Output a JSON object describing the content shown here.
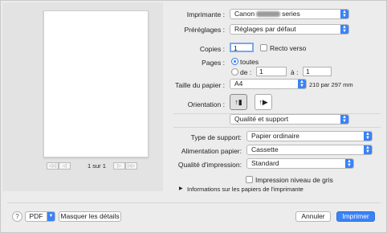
{
  "colors": {
    "accent": "#3a82f6"
  },
  "preview": {
    "first_label": "◁◁",
    "prev_label": "◁",
    "page_count": "1 sur 1",
    "next_label": "▷",
    "last_label": "▷▷"
  },
  "printer": {
    "label": "Imprimante :",
    "value_prefix": "Canon",
    "value_suffix": "series"
  },
  "presets": {
    "label": "Préréglages :",
    "value": "Réglages par défaut"
  },
  "copies": {
    "label": "Copies :",
    "value": "1",
    "two_sided_label": "Recto verso",
    "two_sided_checked": false
  },
  "pages": {
    "label": "Pages :",
    "all_label": "toutes",
    "all_selected": true,
    "from_label": "de :",
    "from_value": "1",
    "to_label": "à :",
    "to_value": "1"
  },
  "paper_size": {
    "label": "Taille du papier :",
    "value": "A4",
    "dimensions": "210 par 297 mm"
  },
  "orientation": {
    "label": "Orientation :",
    "portrait_icon": "portrait-icon",
    "landscape_icon": "landscape-icon",
    "selected": "portrait"
  },
  "section": {
    "value": "Qualité et support"
  },
  "media_type": {
    "label": "Type de support:",
    "value": "Papier ordinaire"
  },
  "paper_source": {
    "label": "Alimentation papier:",
    "value": "Cassette"
  },
  "print_quality": {
    "label": "Qualité d'impression:",
    "value": "Standard"
  },
  "grayscale": {
    "label": "Impression niveau de gris",
    "checked": false
  },
  "paper_info": {
    "label": "Informations sur les papiers de l'imprimante"
  },
  "footer": {
    "help_label": "?",
    "pdf_label": "PDF",
    "hide_details_label": "Masquer les détails",
    "cancel_label": "Annuler",
    "print_label": "Imprimer"
  }
}
